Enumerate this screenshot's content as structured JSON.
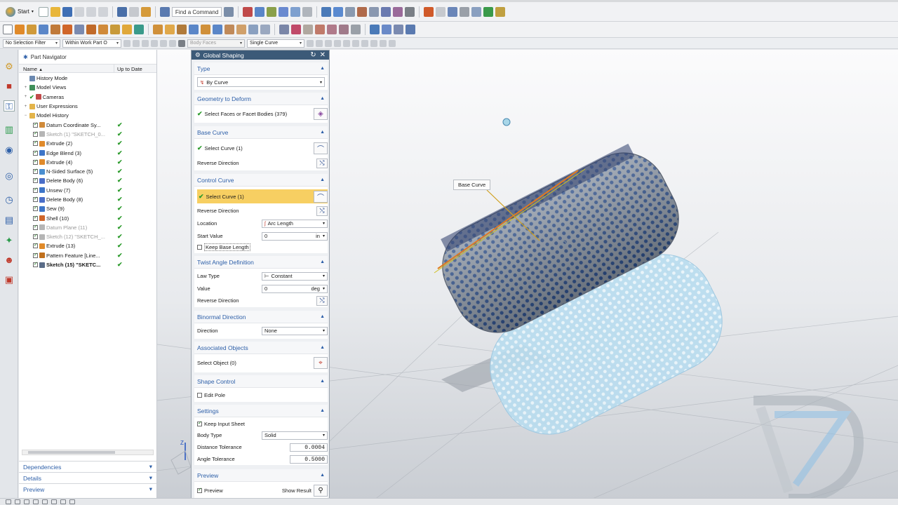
{
  "toolbar": {
    "start_label": "Start",
    "find_command": "Find a Command",
    "selection_filter": "No Selection Filter",
    "scope": "Within Work Part O",
    "face_rule": "Body Faces",
    "curve_rule": "Single Curve"
  },
  "navigator": {
    "title": "Part Navigator",
    "col_name": "Name",
    "col_status": "Up to Date",
    "items": [
      {
        "label": "History Mode",
        "level": 0,
        "icon": "history-icon",
        "color": "#6a88b0"
      },
      {
        "label": "Model Views",
        "level": 0,
        "icon": "model-views-icon",
        "color": "#3f8f5a"
      },
      {
        "label": "Cameras",
        "level": 0,
        "icon": "camera-icon",
        "color": "#c24a4a"
      },
      {
        "label": "User Expressions",
        "level": 0,
        "icon": "folder-icon",
        "color": "#e3b44a"
      },
      {
        "label": "Model History",
        "level": 0,
        "icon": "folder-icon",
        "color": "#e3b44a"
      },
      {
        "label": "Datum Coordinate Sy...",
        "level": 1,
        "icon": "datum-csys-icon",
        "color": "#d08a3a",
        "check": "✔"
      },
      {
        "label": "Sketch (1) \"SKETCH_0...",
        "level": 1,
        "icon": "sketch-icon",
        "color": "#b5b5b5",
        "check": "✔",
        "grey": true
      },
      {
        "label": "Extrude (2)",
        "level": 1,
        "icon": "extrude-icon",
        "color": "#e08a2a",
        "check": "✔"
      },
      {
        "label": "Edge Blend (3)",
        "level": 1,
        "icon": "edge-blend-icon",
        "color": "#3d75c8",
        "check": "✔"
      },
      {
        "label": "Extrude (4)",
        "level": 1,
        "icon": "extrude-icon",
        "color": "#e08a2a",
        "check": "✔"
      },
      {
        "label": "N-Sided Surface (5)",
        "level": 1,
        "icon": "n-sided-surface-icon",
        "color": "#4a8ed0",
        "check": "✔"
      },
      {
        "label": "Delete Body (6)",
        "level": 1,
        "icon": "delete-body-icon",
        "color": "#4a6ec8",
        "check": "✔"
      },
      {
        "label": "Unsew (7)",
        "level": 1,
        "icon": "unsew-icon",
        "color": "#3d75c8",
        "check": "✔"
      },
      {
        "label": "Delete Body (8)",
        "level": 1,
        "icon": "delete-body-icon",
        "color": "#4a6ec8",
        "check": "✔"
      },
      {
        "label": "Sew (9)",
        "level": 1,
        "icon": "sew-icon",
        "color": "#3d75c8",
        "check": "✔"
      },
      {
        "label": "Shell (10)",
        "level": 1,
        "icon": "shell-icon",
        "color": "#d0662a",
        "check": "✔"
      },
      {
        "label": "Datum Plane (11)",
        "level": 1,
        "icon": "datum-plane-icon",
        "color": "#b5b5b5",
        "check": "✔",
        "grey": true
      },
      {
        "label": "Sketch (12) \"SKETCH_...",
        "level": 1,
        "icon": "sketch-icon",
        "color": "#b5b5b5",
        "check": "✔",
        "grey": true
      },
      {
        "label": "Extrude (13)",
        "level": 1,
        "icon": "extrude-icon",
        "color": "#e08a2a",
        "check": "✔"
      },
      {
        "label": "Pattern Feature [Line...",
        "level": 1,
        "icon": "pattern-icon",
        "color": "#c0701e",
        "check": "✔"
      },
      {
        "label": "Sketch (15) \"SKETC...",
        "level": 1,
        "icon": "sketch-icon",
        "color": "#5a6c88",
        "check": "✔",
        "bold": true
      }
    ],
    "sections": [
      "Dependencies",
      "Details",
      "Preview"
    ]
  },
  "dialog": {
    "title": "Global Shaping",
    "type": {
      "header": "Type",
      "value": "By Curve"
    },
    "geometry": {
      "header": "Geometry to Deform",
      "select_label": "Select Faces or Facet Bodies (379)"
    },
    "base_curve": {
      "header": "Base Curve",
      "select_label": "Select Curve (1)",
      "reverse_label": "Reverse Direction"
    },
    "control_curve": {
      "header": "Control Curve",
      "select_label": "Select Curve (1)",
      "reverse_label": "Reverse Direction",
      "location_label": "Location",
      "location_value": "Arc Length",
      "start_label": "Start Value",
      "start_value": "0",
      "start_unit": "in",
      "keep_base_label": "Keep Base Length"
    },
    "twist": {
      "header": "Twist Angle Definition",
      "law_label": "Law Type",
      "law_value": "Constant",
      "value_label": "Value",
      "value": "0",
      "unit": "deg",
      "reverse_label": "Reverse Direction"
    },
    "binormal": {
      "header": "Binormal Direction",
      "direction_label": "Direction",
      "direction_value": "None"
    },
    "associated": {
      "header": "Associated Objects",
      "select_label": "Select Object (0)"
    },
    "shape_control": {
      "header": "Shape Control",
      "edit_pole_label": "Edit Pole"
    },
    "settings": {
      "header": "Settings",
      "keep_input_label": "Keep Input Sheet",
      "body_type_label": "Body Type",
      "body_type_value": "Solid",
      "distance_label": "Distance Tolerance",
      "distance_value": "0.0004",
      "angle_label": "Angle Tolerance",
      "angle_value": "0.5000"
    },
    "preview": {
      "header": "Preview",
      "preview_label": "Preview",
      "show_result_label": "Show Result"
    }
  },
  "viewport": {
    "callout": "Base Curve"
  }
}
